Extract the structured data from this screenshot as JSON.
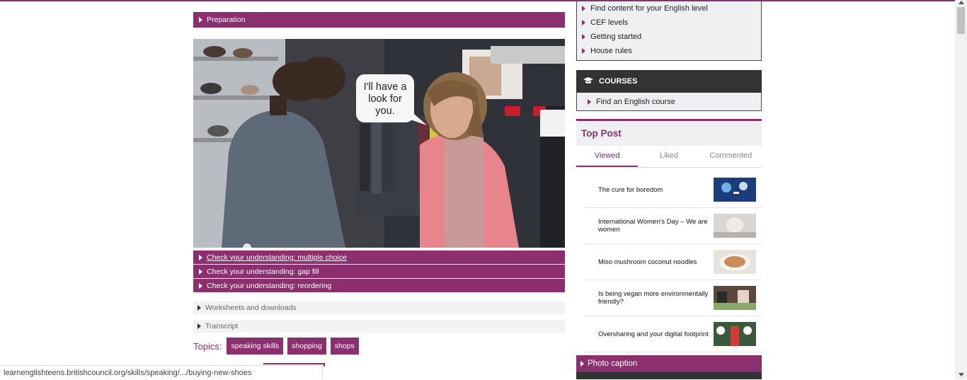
{
  "main": {
    "preparation_label": "Preparation",
    "video": {
      "speech_bubble": "I'll have a look for you."
    },
    "tasks": [
      {
        "label": "Check your understanding: multiple choice"
      },
      {
        "label": "Check your understanding: gap fill"
      },
      {
        "label": "Check your understanding: reordering"
      }
    ],
    "worksheets_label": "Worksheets and downloads",
    "transcript_label": "Transcript",
    "topics": {
      "label": "Topics:",
      "tags": [
        "speaking skills",
        "shopping",
        "shops"
      ]
    }
  },
  "sidebar": {
    "help_links": [
      "Find content for your English level",
      "CEF levels",
      "Getting started",
      "House rules"
    ],
    "courses": {
      "title": "COURSES",
      "link": "Find an English course"
    },
    "top_post": {
      "title": "Top Post",
      "tabs": [
        "Viewed",
        "Liked",
        "Commented"
      ],
      "active_tab": "Viewed",
      "posts": [
        {
          "title": "The cure for boredom"
        },
        {
          "title": "International Women's Day – We are women"
        },
        {
          "title": "Miso mushroom coconut noodles"
        },
        {
          "title": "Is being vegan more environmentally friendly?"
        },
        {
          "title": "Oversharing and your digital footprint"
        }
      ]
    },
    "photo_caption_label": "Photo caption"
  },
  "status_bar": {
    "url": "learnenglishteens.britishcouncil.org/skills/speaking/.../buying-new-shoes"
  },
  "colors": {
    "brand": "#8b2f6e",
    "dark": "#333333",
    "panel": "#eef0f1"
  }
}
